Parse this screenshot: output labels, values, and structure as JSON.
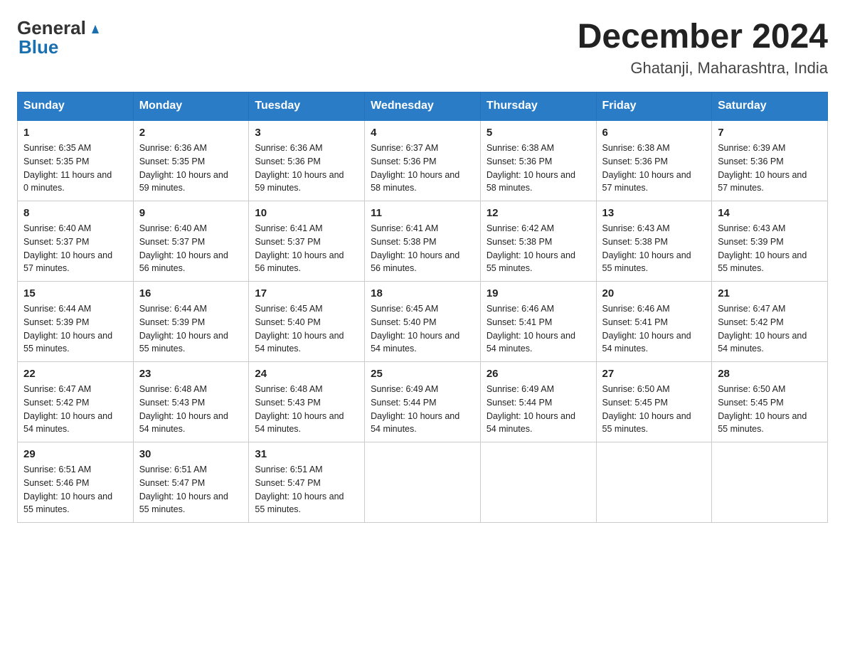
{
  "header": {
    "logo_general": "General",
    "logo_blue": "Blue",
    "month_title": "December 2024",
    "location": "Ghatanji, Maharashtra, India"
  },
  "weekdays": [
    "Sunday",
    "Monday",
    "Tuesday",
    "Wednesday",
    "Thursday",
    "Friday",
    "Saturday"
  ],
  "weeks": [
    [
      {
        "day": "1",
        "sunrise": "6:35 AM",
        "sunset": "5:35 PM",
        "daylight": "11 hours and 0 minutes."
      },
      {
        "day": "2",
        "sunrise": "6:36 AM",
        "sunset": "5:35 PM",
        "daylight": "10 hours and 59 minutes."
      },
      {
        "day": "3",
        "sunrise": "6:36 AM",
        "sunset": "5:36 PM",
        "daylight": "10 hours and 59 minutes."
      },
      {
        "day": "4",
        "sunrise": "6:37 AM",
        "sunset": "5:36 PM",
        "daylight": "10 hours and 58 minutes."
      },
      {
        "day": "5",
        "sunrise": "6:38 AM",
        "sunset": "5:36 PM",
        "daylight": "10 hours and 58 minutes."
      },
      {
        "day": "6",
        "sunrise": "6:38 AM",
        "sunset": "5:36 PM",
        "daylight": "10 hours and 57 minutes."
      },
      {
        "day": "7",
        "sunrise": "6:39 AM",
        "sunset": "5:36 PM",
        "daylight": "10 hours and 57 minutes."
      }
    ],
    [
      {
        "day": "8",
        "sunrise": "6:40 AM",
        "sunset": "5:37 PM",
        "daylight": "10 hours and 57 minutes."
      },
      {
        "day": "9",
        "sunrise": "6:40 AM",
        "sunset": "5:37 PM",
        "daylight": "10 hours and 56 minutes."
      },
      {
        "day": "10",
        "sunrise": "6:41 AM",
        "sunset": "5:37 PM",
        "daylight": "10 hours and 56 minutes."
      },
      {
        "day": "11",
        "sunrise": "6:41 AM",
        "sunset": "5:38 PM",
        "daylight": "10 hours and 56 minutes."
      },
      {
        "day": "12",
        "sunrise": "6:42 AM",
        "sunset": "5:38 PM",
        "daylight": "10 hours and 55 minutes."
      },
      {
        "day": "13",
        "sunrise": "6:43 AM",
        "sunset": "5:38 PM",
        "daylight": "10 hours and 55 minutes."
      },
      {
        "day": "14",
        "sunrise": "6:43 AM",
        "sunset": "5:39 PM",
        "daylight": "10 hours and 55 minutes."
      }
    ],
    [
      {
        "day": "15",
        "sunrise": "6:44 AM",
        "sunset": "5:39 PM",
        "daylight": "10 hours and 55 minutes."
      },
      {
        "day": "16",
        "sunrise": "6:44 AM",
        "sunset": "5:39 PM",
        "daylight": "10 hours and 55 minutes."
      },
      {
        "day": "17",
        "sunrise": "6:45 AM",
        "sunset": "5:40 PM",
        "daylight": "10 hours and 54 minutes."
      },
      {
        "day": "18",
        "sunrise": "6:45 AM",
        "sunset": "5:40 PM",
        "daylight": "10 hours and 54 minutes."
      },
      {
        "day": "19",
        "sunrise": "6:46 AM",
        "sunset": "5:41 PM",
        "daylight": "10 hours and 54 minutes."
      },
      {
        "day": "20",
        "sunrise": "6:46 AM",
        "sunset": "5:41 PM",
        "daylight": "10 hours and 54 minutes."
      },
      {
        "day": "21",
        "sunrise": "6:47 AM",
        "sunset": "5:42 PM",
        "daylight": "10 hours and 54 minutes."
      }
    ],
    [
      {
        "day": "22",
        "sunrise": "6:47 AM",
        "sunset": "5:42 PM",
        "daylight": "10 hours and 54 minutes."
      },
      {
        "day": "23",
        "sunrise": "6:48 AM",
        "sunset": "5:43 PM",
        "daylight": "10 hours and 54 minutes."
      },
      {
        "day": "24",
        "sunrise": "6:48 AM",
        "sunset": "5:43 PM",
        "daylight": "10 hours and 54 minutes."
      },
      {
        "day": "25",
        "sunrise": "6:49 AM",
        "sunset": "5:44 PM",
        "daylight": "10 hours and 54 minutes."
      },
      {
        "day": "26",
        "sunrise": "6:49 AM",
        "sunset": "5:44 PM",
        "daylight": "10 hours and 54 minutes."
      },
      {
        "day": "27",
        "sunrise": "6:50 AM",
        "sunset": "5:45 PM",
        "daylight": "10 hours and 55 minutes."
      },
      {
        "day": "28",
        "sunrise": "6:50 AM",
        "sunset": "5:45 PM",
        "daylight": "10 hours and 55 minutes."
      }
    ],
    [
      {
        "day": "29",
        "sunrise": "6:51 AM",
        "sunset": "5:46 PM",
        "daylight": "10 hours and 55 minutes."
      },
      {
        "day": "30",
        "sunrise": "6:51 AM",
        "sunset": "5:47 PM",
        "daylight": "10 hours and 55 minutes."
      },
      {
        "day": "31",
        "sunrise": "6:51 AM",
        "sunset": "5:47 PM",
        "daylight": "10 hours and 55 minutes."
      },
      null,
      null,
      null,
      null
    ]
  ]
}
